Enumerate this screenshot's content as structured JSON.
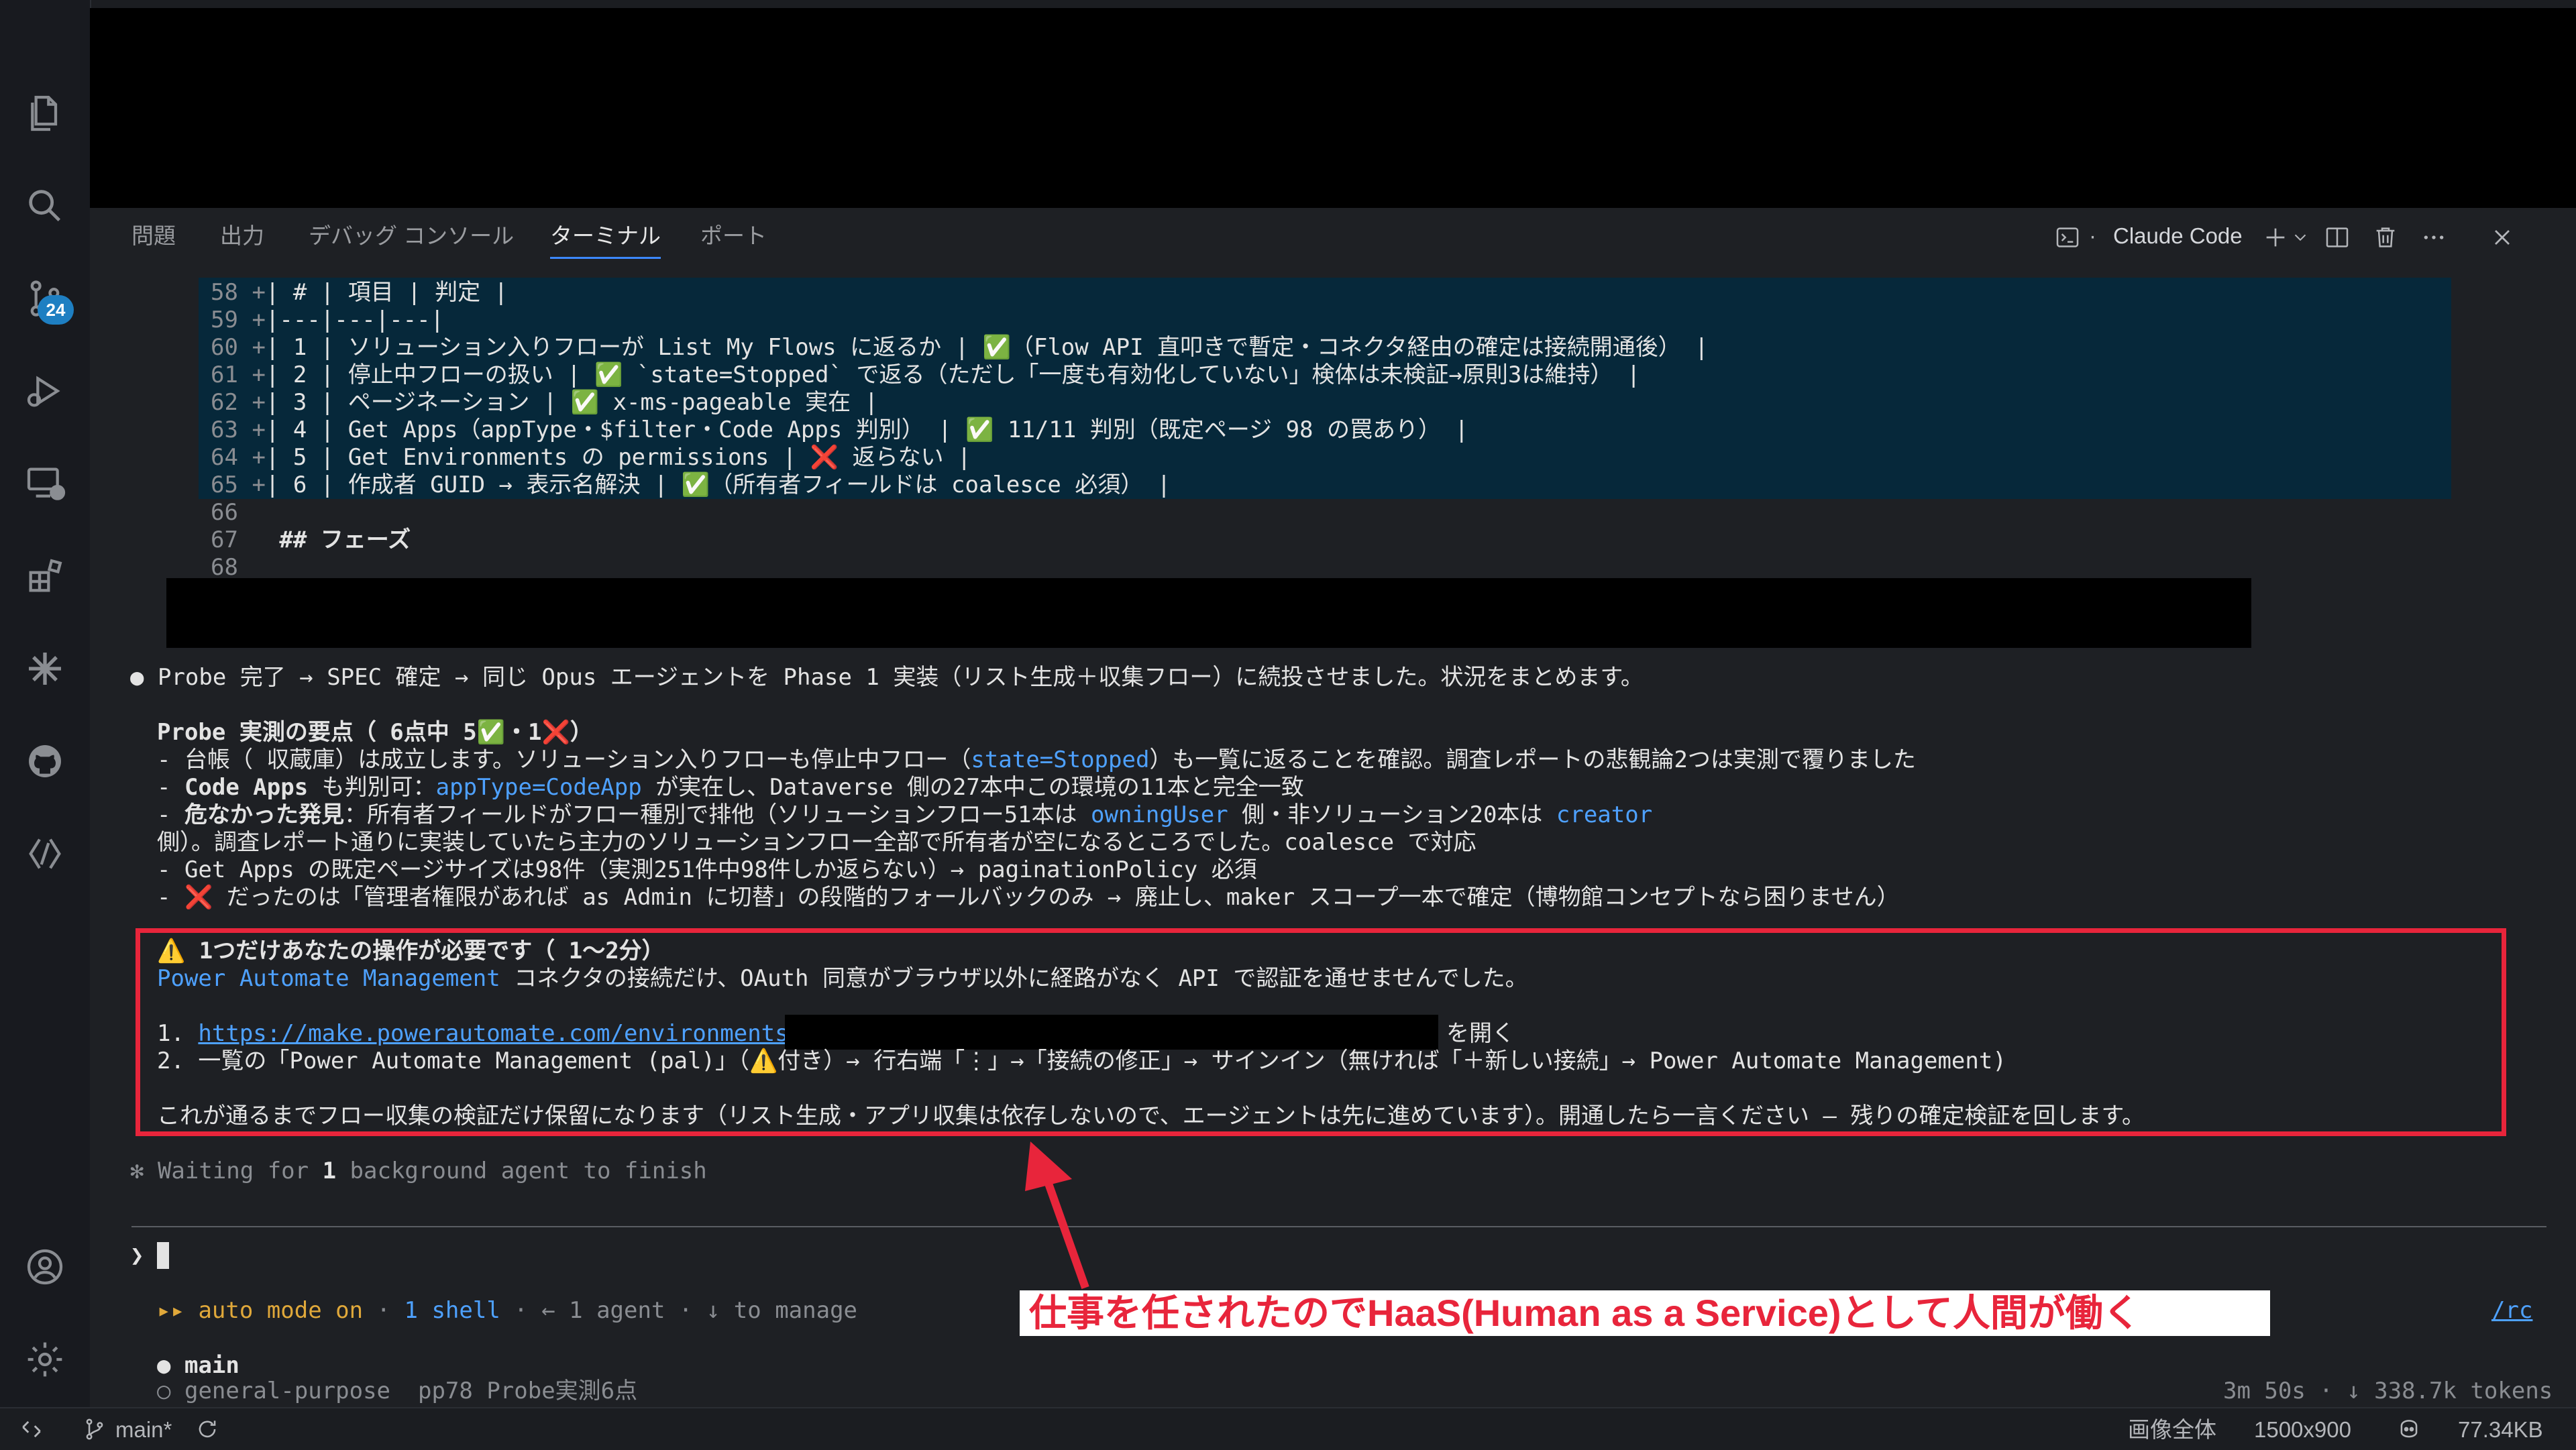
{
  "panel": {
    "tabs": [
      "問題",
      "出力",
      "デバッグ コンソール",
      "ターミナル",
      "ポート"
    ],
    "active_tab": "ターミナル",
    "terminal_name": "Claude Code"
  },
  "activity": {
    "scm_badge": "24"
  },
  "diff_lines": [
    {
      "num": "58",
      "sign": "+",
      "text": "| # | 項目 | 判定 |"
    },
    {
      "num": "59",
      "sign": "+",
      "text": "|---|---|---|"
    },
    {
      "num": "60",
      "sign": "+",
      "text": "| 1 | ソリューション入りフローが List My Flows に返るか | ✅（Flow API 直叩きで暫定・コネクタ経由の確定は接続開通後） |"
    },
    {
      "num": "61",
      "sign": "+",
      "text": "| 2 | 停止中フローの扱い | ✅ `state=Stopped` で返る（ただし「一度も有効化していない」検体は未検証→原則3は維持） |"
    },
    {
      "num": "62",
      "sign": "+",
      "text": "| 3 | ページネーション | ✅ x-ms-pageable 実在 |"
    },
    {
      "num": "63",
      "sign": "+",
      "text": "| 4 | Get Apps（appType・$filter・Code Apps 判別） | ✅ 11/11 判別（既定ページ 98 の罠あり） |"
    },
    {
      "num": "64",
      "sign": "+",
      "text": "| 5 | Get Environments の permissions | ❌ 返らない |"
    },
    {
      "num": "65",
      "sign": "+",
      "text": "| 6 | 作成者 GUID → 表示名解決 | ✅（所有者フィールドは coalesce 必須） |"
    }
  ],
  "plain_lines": [
    {
      "num": "66",
      "text": ""
    },
    {
      "num": "67",
      "text": "## フェーズ"
    },
    {
      "num": "68",
      "text": ""
    }
  ],
  "message": {
    "bullet": "●",
    "intro": "Probe 完了 → SPEC 確定 → 同じ Opus エージェントを Phase 1 実装（リスト生成＋収集フロー）に続投させました。状況をまとめます。",
    "probe_heading": "Probe 実測の要点（ 6点中 5✅・1❌）",
    "b1_pre": "- 台帳（ 収蔵庫）は成立します。ソリューション入りフローも停止中フロー（",
    "b1_code": "state=Stopped",
    "b1_post": "）も一覧に返ることを確認。調査レポートの悲観論2つは実測で覆りました",
    "b2_dash": "- ",
    "b2_bold": "Code Apps",
    "b2_mid": " も判別可：",
    "b2_code": "appType=CodeApp",
    "b2_post": " が実在し、Dataverse 側の27本中この環境の11本と完全一致",
    "b3_dash": "- ",
    "b3_bold": "危なかった発見",
    "b3_mid": "：所有者フィールドがフロー種別で排他（ソリューションフロー51本は ",
    "b3_code1": "owningUser",
    "b3_mid2": " 側・非ソリューション20本は ",
    "b3_code2": "creator",
    "b3_cont": "側）。調査レポート通りに実装していたら主力のソリューションフロー全部で所有者が空になるところでした。coalesce で対応",
    "b4": "- Get Apps の既定ページサイズは98件（実測251件中98件しか返らない）→ paginationPolicy 必須",
    "b5": "- ❌ だったのは「管理者権限があれば as Admin に切替」の段階的フォールバックのみ → 廃止し、maker スコープ一本で確定（博物館コンセプトなら困りません）"
  },
  "action": {
    "heading": "⚠️ 1つだけあなたの操作が必要です（ 1～2分）",
    "line1_code": "Power Automate Management",
    "line1_post": " コネクタの接続だけ、OAuth 同意がブラウザ以外に経路がなく API で認証を通せませんでした。",
    "step1_num": "1. ",
    "step1_url": "https://make.powerautomate.com/environments/",
    "step1_post": "を開く",
    "step2": "2. 一覧の「Power Automate Management (pal)」（⚠️付き）→ 行右端「⋮」→「接続の修正」→ サインイン（無ければ「＋新しい接続」→ Power Automate Management)",
    "footer": "これが通るまでフロー収集の検証だけ保留になります（リスト生成・アプリ収集は依存しないので、エージェントは先に進めています）。開通したら一言ください — 残りの確定検証を回します。"
  },
  "waiting": {
    "pre": "✻ Waiting for ",
    "count": "1",
    "post": " background agent to finish"
  },
  "prompt_symbol": "❯",
  "mode_bar": {
    "arrows": "▸▸",
    "mode": "auto mode on",
    "sep1": " · ",
    "shell": "1 shell",
    "rest": " · ← 1 agent · ↓ to manage",
    "link": "/rc"
  },
  "annotation": "仕事を任されたのでHaaS(Human as a Service)として人間が働く",
  "tasks": {
    "main_bullet": "●",
    "main": "main",
    "sub_bullet": "○",
    "sub_type": "general-purpose",
    "sub_desc": "pp78 Probe実測6点",
    "stats": "3m 50s · ↓ 338.7k tokens"
  },
  "statusbar": {
    "branch": "main*",
    "image_label": "画像全体",
    "dims": "1500x900",
    "size": "77.34KB"
  }
}
